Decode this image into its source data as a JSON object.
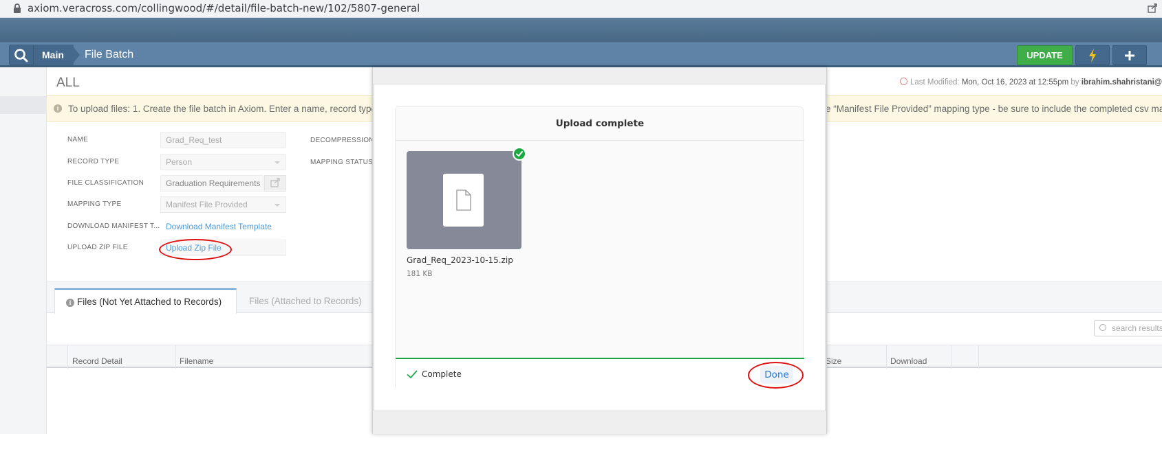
{
  "browser": {
    "url": "axiom.veracross.com/collingwood/#/detail/file-batch-new/102/5807-general"
  },
  "header": {
    "breadcrumb_main": "Main",
    "title": "File Batch",
    "update_label": "UPDATE"
  },
  "page": {
    "heading": "ALL",
    "last_modified_label": "Last Modified:",
    "last_modified_value": "Mon, Oct 16, 2023 at 12:55pm",
    "by_label": "by",
    "modified_by": "ibrahim.shahristani@col"
  },
  "info": {
    "text_left": "To upload files: 1. Create the file batch in Axiom. Enter a name, record type,",
    "text_right": "e “Manifest File Provided” mapping type - be sure to include the completed csv ma"
  },
  "form": {
    "name_label": "NAME",
    "name_value": "Grad_Req_test",
    "record_type_label": "RECORD TYPE",
    "record_type_value": "Person",
    "file_classification_label": "FILE CLASSIFICATION",
    "file_classification_value": "Graduation Requirements",
    "mapping_type_label": "MAPPING TYPE",
    "mapping_type_value": "Manifest File Provided",
    "download_manifest_label": "DOWNLOAD MANIFEST T...",
    "download_manifest_link": "Download Manifest Template",
    "upload_zip_label": "UPLOAD ZIP FILE",
    "upload_zip_link": "Upload Zip File",
    "decompression_label": "DECOMPRESSION S",
    "mapping_status_label": "MAPPING STATUS"
  },
  "tabs": {
    "active": "Files (Not Yet Attached to Records)",
    "inactive": "Files (Attached to Records)"
  },
  "grid": {
    "search_placeholder": "search results",
    "columns": [
      "Record Detail",
      "Filename",
      "Size",
      "Download"
    ]
  },
  "modal": {
    "title": "Upload complete",
    "file_name": "Grad_Req_2023-10-15.zip",
    "file_size": "181 KB",
    "status": "Complete",
    "done_label": "Done"
  },
  "colors": {
    "appbar": "#5f83a6",
    "update_green": "#3fae49",
    "success_green": "#1ba843",
    "link_blue": "#4d9ad8",
    "annotation_red": "#e01010"
  }
}
